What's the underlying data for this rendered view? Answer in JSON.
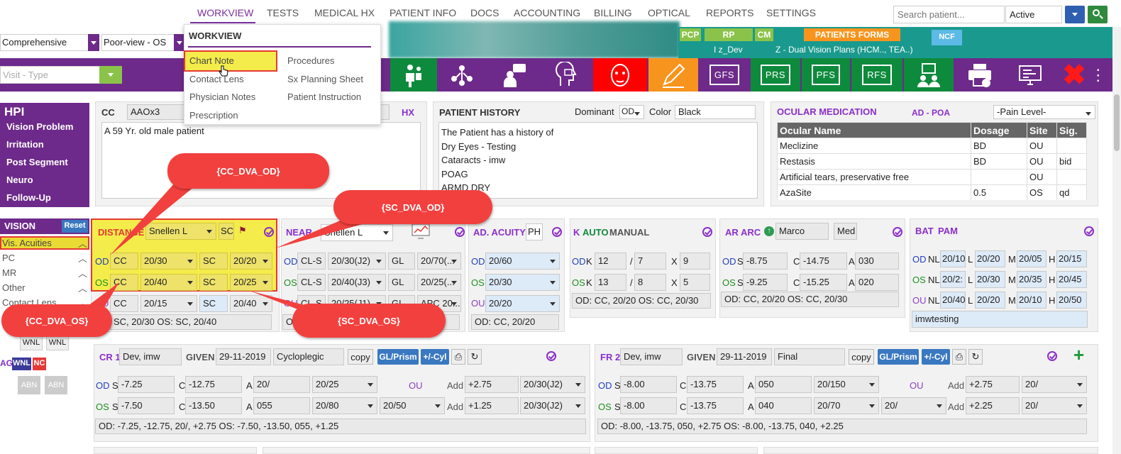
{
  "nav": {
    "items": [
      "WORKVIEW",
      "TESTS",
      "MEDICAL HX",
      "PATIENT INFO",
      "DOCS",
      "ACCOUNTING",
      "BILLING",
      "OPTICAL",
      "REPORTS",
      "SETTINGS"
    ],
    "search_placeholder": "Search patient...",
    "status": "Active"
  },
  "toolbar": {
    "exam_type": "Comprehensive",
    "view": "Poor-view - OS",
    "visit_type_placeholder": "Visit - Type",
    "pcp": "PCP",
    "rp": "RP",
    "cm": "CM",
    "rp_value": "I z_Dev",
    "patients_forms": "PATIENTS FORMS",
    "plan": "Z - Dual Vision Plans (HCM.., TEA..)",
    "ncf": "NCF"
  },
  "icon_bar": {
    "gfs": "GFS",
    "prs": "PRS",
    "pfs": "PFS",
    "rfs": "RFS",
    "colors": {
      "red": "#ff0000",
      "orange": "#f7941d",
      "green": "#0e8a3c",
      "purple": "#6d2a8a"
    }
  },
  "menu": {
    "title": "WORKVIEW",
    "col1": [
      "Chart Note",
      "Contact Lens",
      "Physician Notes",
      "Prescription"
    ],
    "col2": [
      "Procedures",
      "Sx Planning Sheet",
      "Patient Instruction"
    ]
  },
  "hpi": {
    "title": "HPI",
    "items": [
      "Vision Problem",
      "Irritation",
      "Post Segment",
      "Neuro",
      "Follow-Up"
    ]
  },
  "cc": {
    "label": "CC",
    "value": "AAOx3",
    "hx": "HX",
    "text": "A 59 Yr. old male patient"
  },
  "history": {
    "title": "PATIENT HISTORY",
    "dominant_label": "Dominant",
    "dominant": "OD",
    "color_label": "Color",
    "color": "Black",
    "lines": [
      "The Patient has a history of",
      "Dry Eyes - Testing",
      "Cataracts - imw",
      "POAG",
      "ARMD DRY"
    ]
  },
  "ocular": {
    "title": "OCULAR MEDICATION",
    "ad": "AD - POA",
    "pain": "-Pain Level-",
    "headers": [
      "Ocular Name",
      "Dosage",
      "Site",
      "Sig."
    ],
    "rows": [
      [
        "Meclizine",
        "BD",
        "OU",
        ""
      ],
      [
        "Restasis",
        "BD",
        "OU",
        "bid"
      ],
      [
        "Artificial tears, preservative free",
        "",
        "OU",
        ""
      ],
      [
        "AzaSite",
        "0.5",
        "OS",
        "qd"
      ]
    ]
  },
  "vision": {
    "title": "VISION",
    "reset": "Reset",
    "items": [
      "Vis. Acuities",
      "PC",
      "MR",
      "Other",
      "Contact Lens"
    ]
  },
  "distance": {
    "title": "DISTANCE",
    "chart": "Snellen L",
    "sc": "SC",
    "od": [
      "CC",
      "20/30",
      "SC",
      "20/20"
    ],
    "os": [
      "CC",
      "20/40",
      "SC",
      "20/25"
    ],
    "ou": [
      "CC",
      "20/15",
      "SC",
      "20/40"
    ],
    "summary": "SC, 20/30 OS: SC, 20/40"
  },
  "near": {
    "title": "NEAR",
    "chart": "Snellen L",
    "od": [
      "CL-S",
      "20/30(J2)",
      "GL",
      "20/70(..."
    ],
    "os": [
      "CL-S",
      "20/40(J3)",
      "GL",
      "20/25(..."
    ],
    "ou": [
      "CL-S",
      "20/25(J1)",
      "GL",
      "APC 20..."
    ],
    "summary": "OD"
  },
  "ad_acuity": {
    "title": "AD. ACUITY",
    "ph": "PH",
    "od": "20/60",
    "os": "20/30",
    "ou": "20/20",
    "summary": "OD: CC, 20/20"
  },
  "k": {
    "title": "K",
    "auto": "AUTO",
    "manual": "MANUAL",
    "od": [
      "12",
      "7",
      "9"
    ],
    "os": [
      "13",
      "8",
      "5"
    ],
    "summary": "OD: CC, 20/20 OS: CC, 20/30"
  },
  "ar": {
    "title": "AR",
    "arc": "ARC",
    "name": "Marco",
    "med": "Med",
    "od": [
      "-8.75",
      "-14.75",
      "030"
    ],
    "os": [
      "-9.25",
      "-15.25",
      "020"
    ],
    "summary": "OD: CC, 20/20 OS: CC, 20/30"
  },
  "bat": {
    "title": "BAT",
    "pam": "PAM",
    "od": [
      "20/10",
      "20/20",
      "20/05",
      "20/15"
    ],
    "os": [
      "20/2:",
      "20/30",
      "20/35",
      "20/45"
    ],
    "ou": [
      "20/40",
      "20/20",
      "20/10",
      "20/50"
    ],
    "note": "imwtesting"
  },
  "cr": {
    "title": "CR 1",
    "name": "Dev, imw",
    "given": "GIVEN",
    "date": "29-11-2019",
    "type": "Cycloplegic",
    "copy": "copy",
    "gl": "GL/Prism",
    "cyl": "+/-Cyl",
    "od": [
      "-7.25",
      "-12.75",
      "20/",
      "20/25"
    ],
    "os": [
      "-7.50",
      "-13.50",
      "055",
      "20/80",
      "20/50"
    ],
    "ou": "OU",
    "add_od": "+2.75",
    "add_od_va": "20/30(J2)",
    "add_os": "+1.25",
    "add_os_va": "20/30(J2)",
    "summary": "OD: -7.25, -12.75, 20/, +2.75 OS: -7.50, -13.50, 055, +1.25"
  },
  "fr": {
    "title": "FR 2",
    "name": "Dev, imw",
    "given": "GIVEN",
    "date": "29-11-2019",
    "type": "Final",
    "copy": "copy",
    "gl": "GL/Prism",
    "cyl": "+/-Cyl",
    "od": [
      "-8.00",
      "-13.75",
      "050",
      "20/150"
    ],
    "os": [
      "-8.00",
      "-13.75",
      "040",
      "20/70",
      "20/"
    ],
    "ou": "OU",
    "add_od": "+2.75",
    "add_od_va": "20/",
    "add_os": "+2.25",
    "add_os_va": "20/",
    "summary": "OD: -8.00, -13.75, 050, +2.75 OS: -8.00, -13.75, 040, +2.25"
  },
  "left_misc": {
    "wnl": "WNL",
    "ag": "AG",
    "nc": "NC",
    "abn": "ABN"
  },
  "callouts": {
    "cc_od": "{CC_DVA_OD}",
    "sc_od": "{SC_DVA_OD}",
    "cc_os": "{CC_DVA_OS}",
    "sc_os": "{SC_DVA_OS}"
  },
  "labels": {
    "od": "OD",
    "os": "OS",
    "ou": "OU",
    "s": "S",
    "c": "C",
    "a": "A",
    "x": "X",
    "k": "K",
    "add": "Add",
    "nl": "NL",
    "l": "L",
    "m": "M",
    "h": "H",
    "slash": "/"
  }
}
